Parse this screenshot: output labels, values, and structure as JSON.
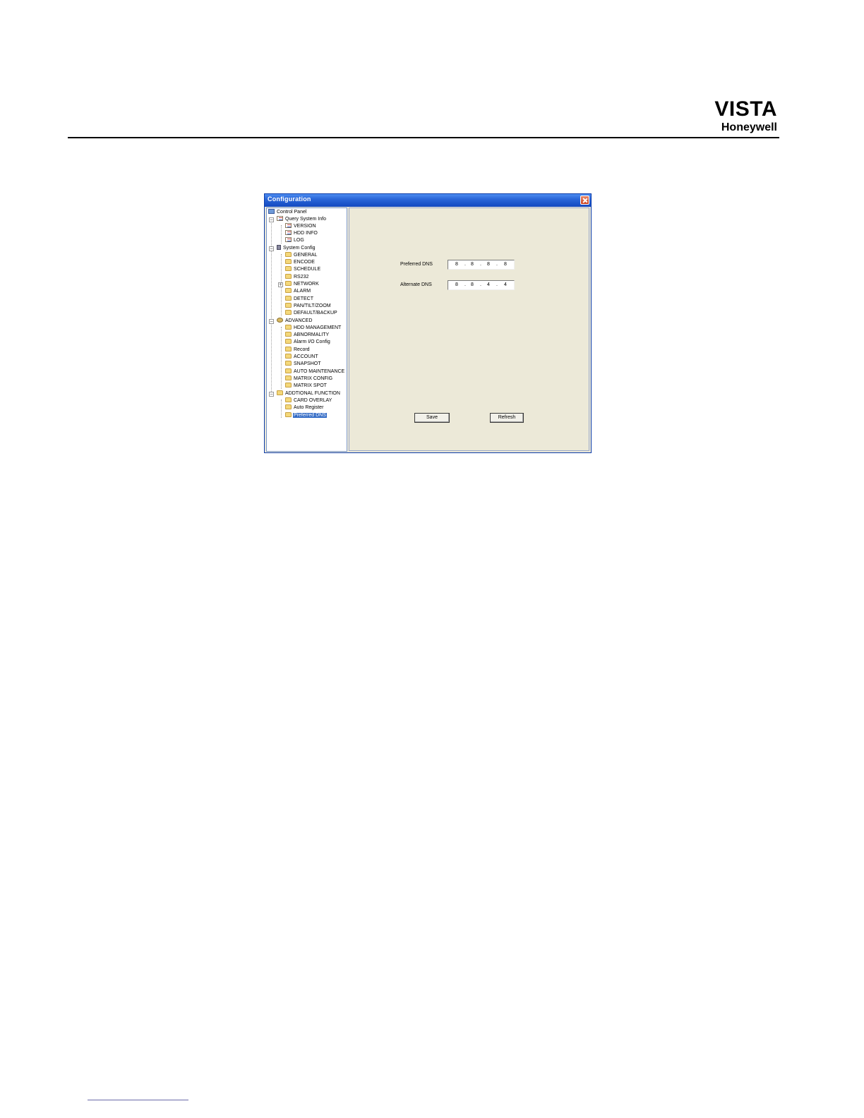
{
  "header": {
    "brand": "VISTA",
    "company": "Honeywell"
  },
  "window": {
    "title": "Configuration"
  },
  "tree": {
    "root": "Control Panel",
    "query_system_info": {
      "label": "Query System Info",
      "children": [
        "VERSION",
        "HDD INFO",
        "LOG"
      ]
    },
    "system_config": {
      "label": "System Config",
      "children": [
        "GENERAL",
        "ENCODE",
        "SCHEDULE",
        "RS232",
        "NETWORK",
        "ALARM",
        "DETECT",
        "PAN/TILT/ZOOM",
        "DEFAULT/BACKUP"
      ]
    },
    "advanced": {
      "label": "ADVANCED",
      "children": [
        "HDD MANAGEMENT",
        "ABNORMALITY",
        "Alarm I/O Config",
        "Record",
        "ACCOUNT",
        "SNAPSHOT",
        "AUTO MAINTENANCE",
        "MATRIX CONFIG",
        "MATRIX SPOT"
      ]
    },
    "additional_function": {
      "label": "ADDTIONAL FUNCTION",
      "children": [
        "CARD OVERLAY",
        "Auto Register",
        "Preferred DNS"
      ]
    },
    "selected": "Preferred DNS"
  },
  "form": {
    "preferred_dns": {
      "label": "Preferred DNS",
      "octets": [
        "8",
        "8",
        "8",
        "8"
      ]
    },
    "alternate_dns": {
      "label": "Alternate DNS",
      "octets": [
        "8",
        "8",
        "4",
        "4"
      ]
    },
    "save_label": "Save",
    "refresh_label": "Refresh"
  },
  "icons": {
    "window_close": "close-icon",
    "root": "monitor-icon",
    "doc_items": "document-icon",
    "system_config": "tools-icon",
    "advanced": "gears-icon",
    "folders": "folder-icon"
  }
}
